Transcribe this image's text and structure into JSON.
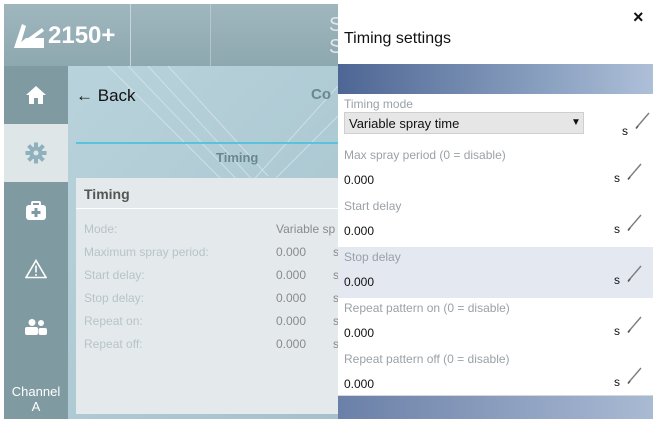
{
  "app": {
    "title": "2150+",
    "ghost_letters": [
      "S",
      "S"
    ],
    "channel_label": "Channel",
    "channel_value": "A"
  },
  "nav": {
    "back_label": "Back",
    "header_partial": "Co",
    "section_title": "Timing"
  },
  "card": {
    "title": "Timing",
    "rows": [
      {
        "label": "Mode:",
        "value": "Variable sp",
        "unit": ""
      },
      {
        "label": "Maximum spray period:",
        "value": "0.000",
        "unit": "s"
      },
      {
        "label": "Start delay:",
        "value": "0.000",
        "unit": "s"
      },
      {
        "label": "Stop delay:",
        "value": "0.000",
        "unit": "s"
      },
      {
        "label": "Repeat on:",
        "value": "0.000",
        "unit": "s"
      },
      {
        "label": "Repeat off:",
        "value": "0.000",
        "unit": "s"
      }
    ]
  },
  "panel": {
    "title": "Timing settings",
    "close_label": "×",
    "fields": [
      {
        "label": "Timing mode",
        "value": "Variable spray time",
        "unit": "s",
        "type": "select"
      },
      {
        "label": "Max spray period (0 = disable)",
        "value": "0.000",
        "unit": "s"
      },
      {
        "label": "Start delay",
        "value": "0.000",
        "unit": "s"
      },
      {
        "label": "Stop delay",
        "value": "0.000",
        "unit": "s"
      },
      {
        "label": "Repeat pattern on (0 = disable)",
        "value": "0.000",
        "unit": "s"
      },
      {
        "label": "Repeat pattern off (0 = disable)",
        "value": "0.000",
        "unit": "s"
      }
    ]
  },
  "colors": {
    "accent": "#59c2dd",
    "sidebar": "#7f9aa1",
    "panel_band": "#4e6694",
    "highlight_row": "#e3e8f1"
  },
  "icons": [
    "logo-icon",
    "home-icon",
    "gear-icon",
    "first-aid-icon",
    "warning-icon",
    "users-icon",
    "pencil-icon",
    "chevron-down-icon",
    "close-icon",
    "back-arrow-icon"
  ]
}
